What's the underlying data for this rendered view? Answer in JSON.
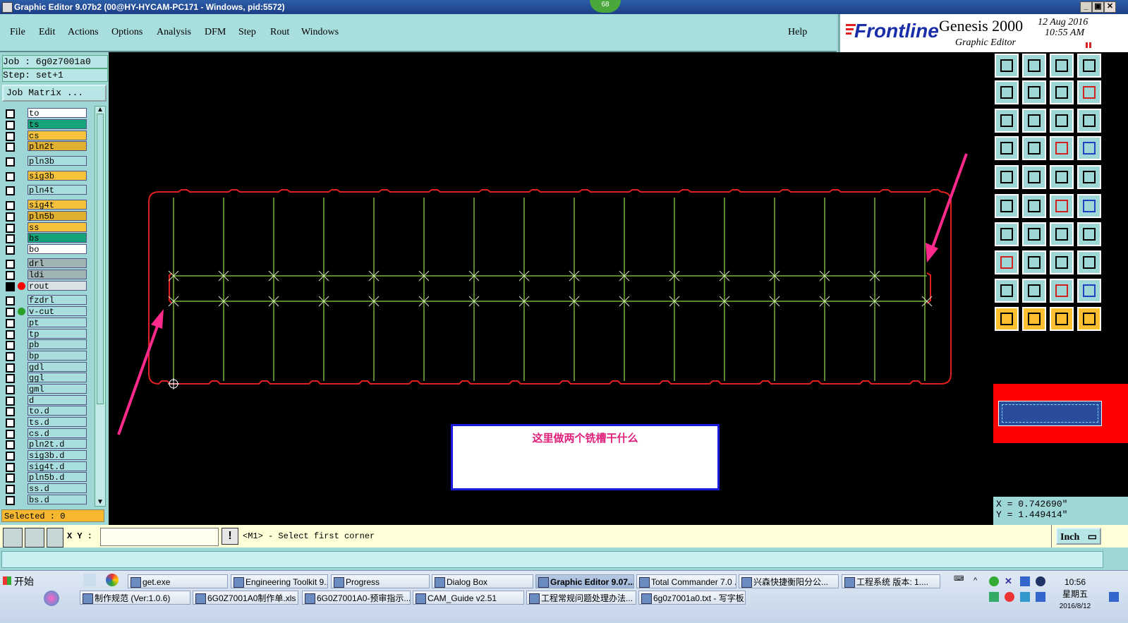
{
  "window": {
    "title": "Graphic Editor 9.07b2 (00@HY-HYCAM-PC171 - Windows, pid:5572)",
    "badge": "68",
    "min_label": "_",
    "max_label": "▣",
    "close_label": "✕"
  },
  "menu": [
    "File",
    "Edit",
    "Actions",
    "Options",
    "Analysis",
    "DFM",
    "Step",
    "Rout",
    "Windows"
  ],
  "help_label": "Help",
  "logo": {
    "brand": "Frontline",
    "product": "Genesis 2000",
    "subtitle": "Graphic Editor",
    "date": "12 Aug 2016",
    "time": "10:55 AM"
  },
  "job": {
    "job_line": "Job : 6g0z7001a0",
    "step_line": "Step: set+1",
    "matrix_button": "Job Matrix ..."
  },
  "layers": [
    {
      "name": "to",
      "color": "#ffffff",
      "dot": ""
    },
    {
      "name": "ts",
      "color": "#16a37a",
      "dot": ""
    },
    {
      "name": "cs",
      "color": "#f5c33b",
      "dot": ""
    },
    {
      "name": "pln2t",
      "color": "#e0b030",
      "dot": ""
    },
    {
      "name": "pln3b",
      "color": "#a9dede",
      "dot": ""
    },
    {
      "name": "sig3b",
      "color": "#f5c33b",
      "dot": ""
    },
    {
      "name": "pln4t",
      "color": "#a9dede",
      "dot": ""
    },
    {
      "name": "sig4t",
      "color": "#f5c33b",
      "dot": ""
    },
    {
      "name": "pln5b",
      "color": "#e0b030",
      "dot": ""
    },
    {
      "name": "ss",
      "color": "#f5c33b",
      "dot": ""
    },
    {
      "name": "bs",
      "color": "#16a37a",
      "dot": ""
    },
    {
      "name": "bo",
      "color": "#ffffff",
      "dot": ""
    },
    {
      "name": "drl",
      "color": "#a0b4b4",
      "dot": ""
    },
    {
      "name": "ldi",
      "color": "#a0b4b4",
      "dot": ""
    },
    {
      "name": "rout",
      "color": "#d8e2e2",
      "dot": "#ff0000"
    },
    {
      "name": "fzdrl",
      "color": "#a9dede",
      "dot": ""
    },
    {
      "name": "v-cut",
      "color": "#a9dede",
      "dot": "#2aa02a"
    },
    {
      "name": "pt",
      "color": "#a9dede",
      "dot": ""
    },
    {
      "name": "tp",
      "color": "#a9dede",
      "dot": ""
    },
    {
      "name": "pb",
      "color": "#a9dede",
      "dot": ""
    },
    {
      "name": "bp",
      "color": "#a9dede",
      "dot": ""
    },
    {
      "name": "gdl",
      "color": "#a9dede",
      "dot": ""
    },
    {
      "name": "ggl",
      "color": "#a9dede",
      "dot": ""
    },
    {
      "name": "gml",
      "color": "#a9dede",
      "dot": ""
    },
    {
      "name": "d",
      "color": "#a9dede",
      "dot": ""
    },
    {
      "name": "to.d",
      "color": "#a9dede",
      "dot": ""
    },
    {
      "name": "ts.d",
      "color": "#a9dede",
      "dot": ""
    },
    {
      "name": "cs.d",
      "color": "#a9dede",
      "dot": ""
    },
    {
      "name": "pln2t.d",
      "color": "#a9dede",
      "dot": ""
    },
    {
      "name": "sig3b.d",
      "color": "#a9dede",
      "dot": ""
    },
    {
      "name": "sig4t.d",
      "color": "#a9dede",
      "dot": ""
    },
    {
      "name": "pln5b.d",
      "color": "#a9dede",
      "dot": ""
    },
    {
      "name": "ss.d",
      "color": "#a9dede",
      "dot": ""
    },
    {
      "name": "bs.d",
      "color": "#a9dede",
      "dot": ""
    }
  ],
  "selected_label": "Selected : 0",
  "annotation_text": "这里做两个铣槽干什么",
  "coords": {
    "x": "X = 0.742690\"",
    "y": "Y = 1.449414\""
  },
  "xy_label": "X Y :",
  "prompt_text": "<M1> - Select first corner",
  "unit_label": "Inch",
  "taskbar": {
    "start_label": "开始",
    "row1": [
      "get.exe",
      "Engineering Toolkit 9....",
      "Progress",
      "Dialog Box",
      "Graphic Editor 9.07...",
      "Total Commander 7.0 ...",
      "兴森快捷衡阳分公...",
      "工程系统  版本: 1...."
    ],
    "row2": [
      "制作规范 (Ver:1.0.6)",
      "6G0Z7001A0制作单.xls ...",
      "6G0Z7001A0-预审指示....",
      "CAM_Guide v2.51",
      "工程常规问题处理办法...",
      "6g0z7001a0.txt - 写字板"
    ],
    "clock_time": "10:56",
    "clock_day": "星期五",
    "clock_date": "2016/8/12"
  },
  "colors": {
    "outline": "#e02020",
    "vcut": "#7ab33a",
    "arrow": "#ff2a8c",
    "annotation_text": "#e0207a"
  }
}
